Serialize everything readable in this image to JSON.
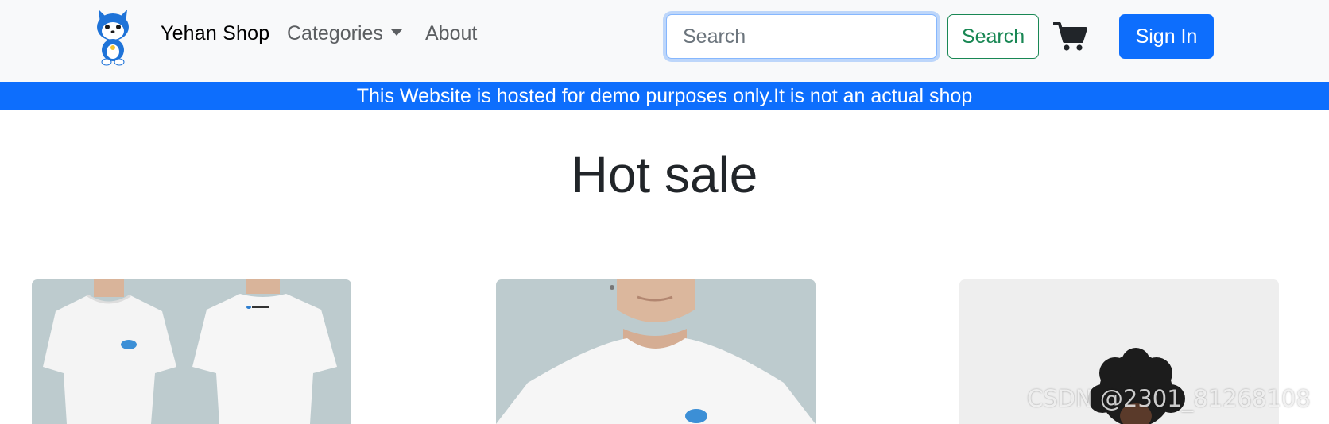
{
  "navbar": {
    "brand": "Yehan Shop",
    "categories_label": "Categories",
    "about_label": "About",
    "search": {
      "placeholder": "Search",
      "value": ""
    },
    "search_button": "Search",
    "sign_in_button": "Sign In",
    "cart_icon": "shopping-cart-icon",
    "logo_icon": "husky-mascot-icon"
  },
  "banner": {
    "text": "This Website is hosted for demo purposes only.It is not an actual shop"
  },
  "main": {
    "title": "Hot sale"
  },
  "watermark": "CSDN @2301_81268108",
  "colors": {
    "primary": "#0d6efd",
    "success": "#198754",
    "navbar_bg": "#f8f9fa",
    "card_bg_1": "#bdcbce",
    "card_bg_2": "#bdcbce",
    "card_bg_3": "#eeeeee"
  }
}
